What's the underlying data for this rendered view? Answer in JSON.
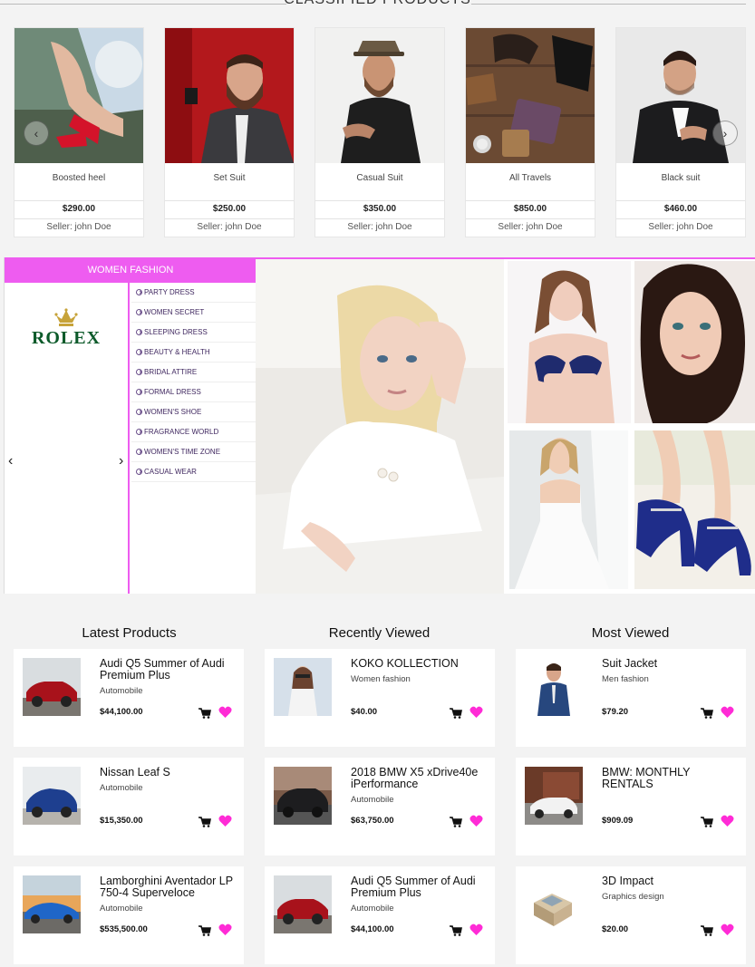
{
  "classified": {
    "title": "CLASSIFIED PRODUCTS",
    "products": [
      {
        "name": "Boosted heel",
        "price": "$290.00",
        "seller": "Seller: john Doe"
      },
      {
        "name": "Set Suit",
        "price": "$250.00",
        "seller": "Seller: john Doe"
      },
      {
        "name": "Casual Suit",
        "price": "$350.00",
        "seller": "Seller: john Doe"
      },
      {
        "name": "All Travels",
        "price": "$850.00",
        "seller": "Seller: john Doe"
      },
      {
        "name": "Black suit",
        "price": "$460.00",
        "seller": "Seller: john Doe"
      }
    ]
  },
  "women_fashion": {
    "title": "WOMEN FASHION",
    "brand": "ROLEX",
    "menu": [
      "PARTY DRESS",
      "WOMEN SECRET",
      "SLEEPING DRESS",
      "BEAUTY & HEALTH",
      "BRIDAL ATTIRE",
      "FORMAL DRESS",
      "WOMEN'S SHOE",
      "FRAGRANCE WORLD",
      "WOMEN'S TIME ZONE",
      "CASUAL WEAR"
    ]
  },
  "lists": {
    "latest": {
      "title": "Latest Products",
      "items": [
        {
          "title": "Audi Q5 Summer of Audi Premium Plus",
          "category": "Automobile",
          "price": "$44,100.00"
        },
        {
          "title": "Nissan Leaf S",
          "category": "Automobile",
          "price": "$15,350.00"
        },
        {
          "title": "Lamborghini Aventador LP 750-4 Superveloce",
          "category": "Automobile",
          "price": "$535,500.00"
        }
      ]
    },
    "recent": {
      "title": "Recently Viewed",
      "items": [
        {
          "title": "KOKO KOLLECTION",
          "category": "Women fashion",
          "price": "$40.00"
        },
        {
          "title": "2018 BMW X5 xDrive40e iPerformance",
          "category": "Automobile",
          "price": "$63,750.00"
        },
        {
          "title": "Audi Q5 Summer of Audi Premium Plus",
          "category": "Automobile",
          "price": "$44,100.00"
        }
      ]
    },
    "most": {
      "title": "Most Viewed",
      "items": [
        {
          "title": "Suit Jacket",
          "category": "Men fashion",
          "price": "$79.20"
        },
        {
          "title": "BMW: MONTHLY RENTALS",
          "category": "",
          "price": "$909.09"
        },
        {
          "title": "3D Impact",
          "category": "Graphics design",
          "price": "$20.00"
        }
      ]
    }
  },
  "colors": {
    "accent": "#ee5cf0",
    "heart": "#ff2bd6",
    "rolex_green": "#0c5a2a"
  }
}
